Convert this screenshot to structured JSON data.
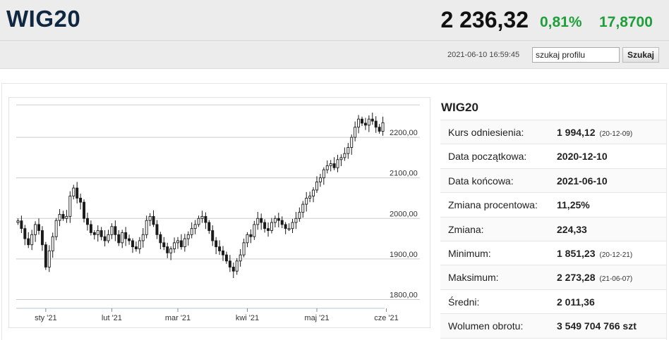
{
  "header": {
    "index_name": "WIG20",
    "value": "2 236,32",
    "change_pct": "0,81%",
    "change_abs": "17,8700",
    "timestamp": "2021-06-10 16:59:45",
    "search_placeholder": "szukaj profilu",
    "search_value": "szukaj profilu",
    "search_button": "Szukaj"
  },
  "colors": {
    "accent_green": "#1f9f3a",
    "title_navy": "#0f2740",
    "candle_up": "#ffffff",
    "candle_down": "#1a1a1a"
  },
  "info": {
    "title": "WIG20",
    "rows": [
      {
        "label": "Kurs odniesienia:",
        "value": "1 994,12",
        "date": "(20-12-09)"
      },
      {
        "label": "Data początkowa:",
        "value": "2020-12-10",
        "date": ""
      },
      {
        "label": "Data końcowa:",
        "value": "2021-06-10",
        "date": ""
      },
      {
        "label": "Zmiana procentowa:",
        "value": "11,25%",
        "date": ""
      },
      {
        "label": "Zmiana:",
        "value": "224,33",
        "date": ""
      },
      {
        "label": "Minimum:",
        "value": "1 851,23",
        "date": "(20-12-21)"
      },
      {
        "label": "Maksimum:",
        "value": "2 273,28",
        "date": "(21-06-07)"
      },
      {
        "label": "Średni:",
        "value": "2 011,36",
        "date": ""
      },
      {
        "label": "Wolumen obrotu:",
        "value": "3 549 704 766 szt",
        "date": ""
      }
    ]
  },
  "chart_data": {
    "type": "candlestick",
    "ylim": [
      1780,
      2280
    ],
    "y_ticks": [
      1800,
      1900,
      2000,
      2100,
      2200
    ],
    "y_tick_labels": [
      "1800,00",
      "1900,00",
      "2000,00",
      "2100,00",
      "2200,00"
    ],
    "x_tick_labels": [
      "sty '21",
      "lut '21",
      "mar '21",
      "kwi '21",
      "maj '21",
      "cze '21"
    ],
    "x_tick_index": [
      8,
      27,
      46,
      66,
      86,
      106
    ],
    "grid": true,
    "closes": [
      1994,
      1975,
      1950,
      1935,
      1960,
      1985,
      1970,
      1935,
      1880,
      1920,
      1955,
      1995,
      2010,
      2000,
      2005,
      2055,
      2075,
      2050,
      2040,
      2000,
      1985,
      1965,
      1960,
      1970,
      1955,
      1945,
      1960,
      1980,
      1960,
      1940,
      1965,
      1950,
      1945,
      1930,
      1925,
      1945,
      1960,
      1995,
      2005,
      1985,
      1960,
      1940,
      1930,
      1915,
      1925,
      1940,
      1945,
      1930,
      1950,
      1960,
      1975,
      1985,
      2000,
      2005,
      1990,
      1970,
      1945,
      1930,
      1920,
      1910,
      1895,
      1880,
      1870,
      1895,
      1910,
      1940,
      1960,
      1955,
      1985,
      2000,
      1990,
      1975,
      1970,
      1990,
      2000,
      1995,
      1985,
      1975,
      1975,
      1990,
      2000,
      2015,
      2035,
      2050,
      2055,
      2070,
      2090,
      2100,
      2120,
      2130,
      2135,
      2125,
      2145,
      2150,
      2160,
      2175,
      2200,
      2225,
      2245,
      2235,
      2230,
      2245,
      2240,
      2225,
      2215,
      2236
    ]
  }
}
